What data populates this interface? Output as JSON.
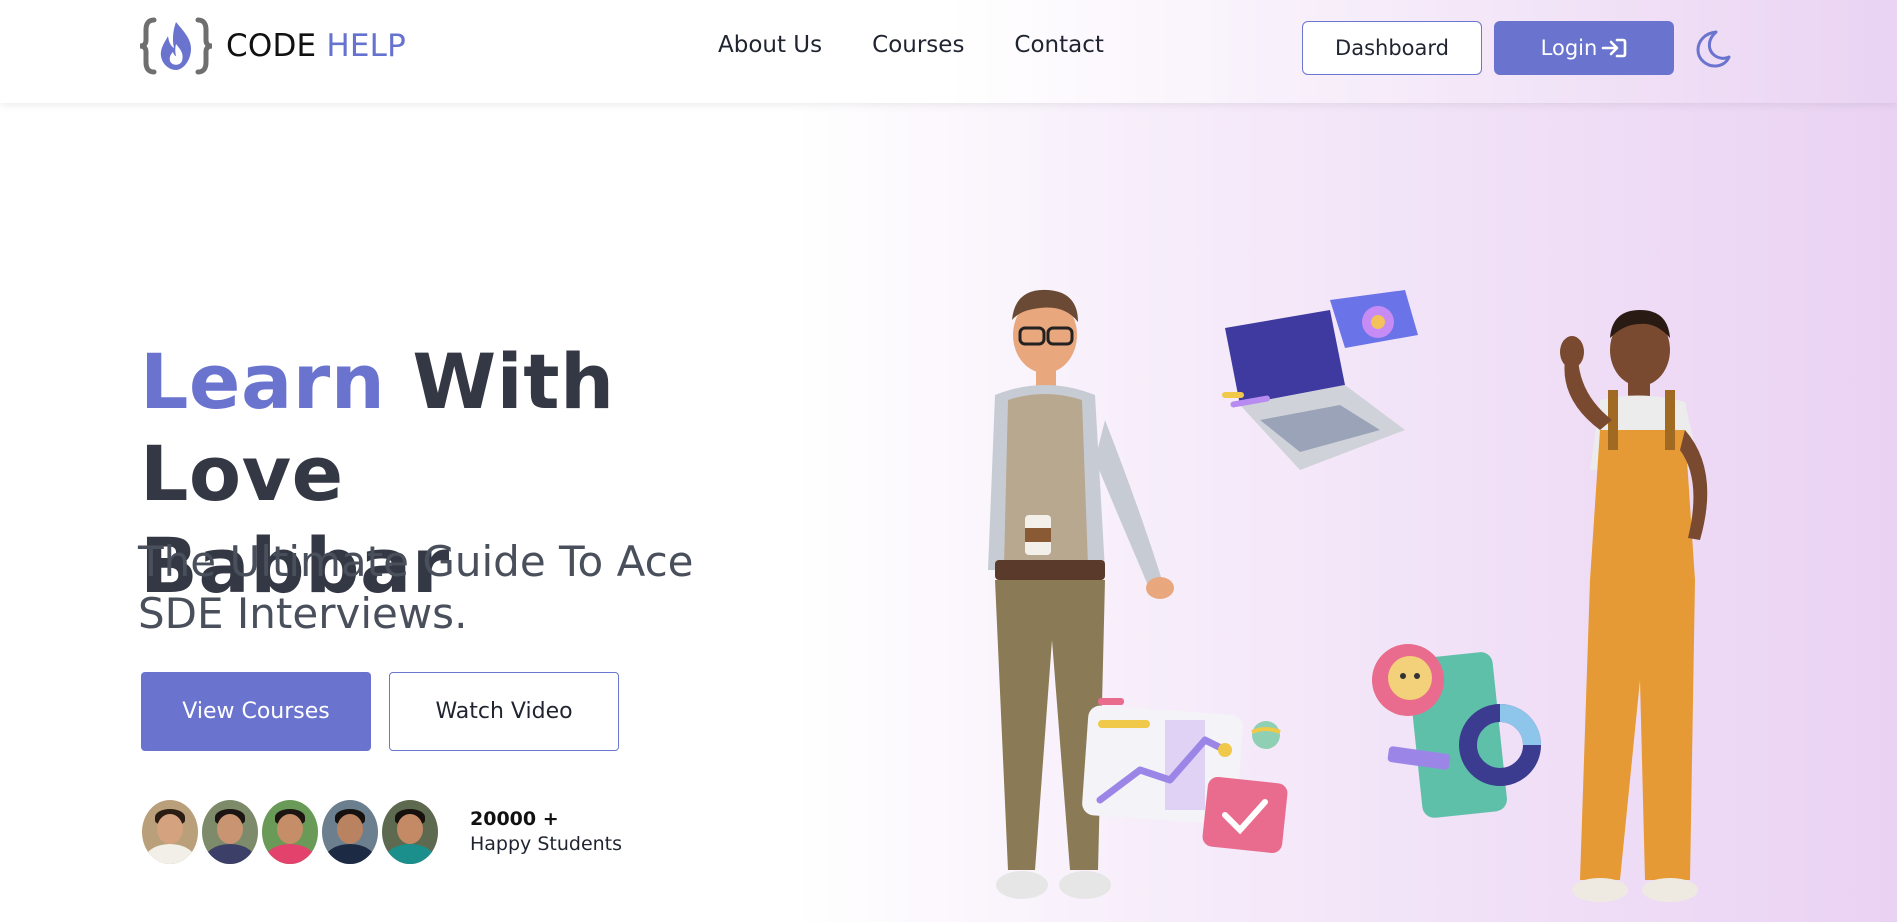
{
  "brand": {
    "name_part1": "CODE",
    "name_part2": "HELP",
    "accent_color": "#6a74cf"
  },
  "nav": {
    "items": [
      "About Us",
      "Courses",
      "Contact"
    ]
  },
  "header_actions": {
    "dashboard_label": "Dashboard",
    "login_label": "Login",
    "theme_toggle_icon": "moon-icon"
  },
  "hero": {
    "title_accent": "Learn",
    "title_rest_line1": "With Love",
    "title_line2": "Babbar",
    "subtitle": "The Ultimate Guide To Ace SDE Interviews.",
    "primary_button": "View Courses",
    "secondary_button": "Watch Video"
  },
  "social_proof": {
    "count": "20000 +",
    "label": "Happy Students",
    "avatar_count": 5
  },
  "colors": {
    "primary": "#6a74cf",
    "text_dark": "#343844",
    "bg_gradient_end": "#ead2f3"
  }
}
